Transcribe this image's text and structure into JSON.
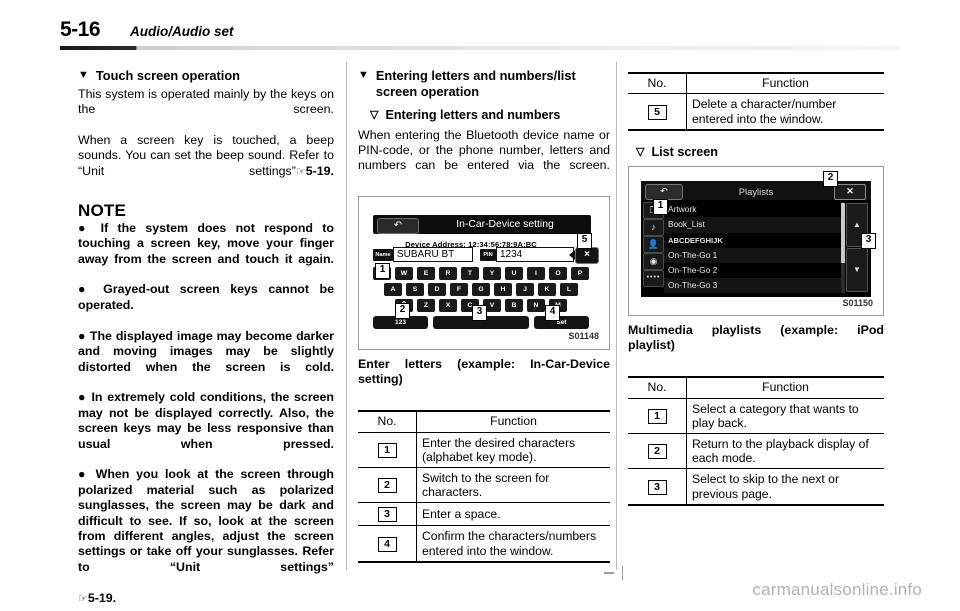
{
  "header": {
    "page_number": "5-16",
    "section_title": "Audio/Audio set"
  },
  "column1": {
    "heading": "Touch screen operation",
    "para1": "This system is operated mainly by the keys on the screen.",
    "para2": "When a screen key is touched, a beep sounds. You can set the beep sound. Refer to “Unit settings”",
    "para2_ref": "5-19.",
    "note_title": "NOTE",
    "bullets": [
      "If the system does not respond to touching a screen key, move your finger away from the screen and touch it again.",
      "Grayed-out screen keys cannot be operated.",
      "The displayed image may become darker and moving images may be slightly distorted when the screen is cold.",
      "In extremely cold conditions, the screen may not be displayed correctly. Also, the screen keys may be less responsive than usual when pressed.",
      "When you look at the screen through polarized material such as polarized sunglasses, the screen may be dark and difficult to see. If so, look at the screen from different angles, adjust the screen settings or take off your sunglasses. Refer to “Unit settings”"
    ],
    "last_ref": "5-19."
  },
  "column2": {
    "heading": "Entering letters and numbers/list screen operation",
    "subheading": "Entering letters and numbers",
    "para": "When entering the Bluetooth device name or PIN-code, or the phone number, letters and numbers can be entered via the screen.",
    "figure": {
      "id": "S01148",
      "back_icon": "back-arrow-icon",
      "title": "In-Car-Device setting",
      "device_address": "Device Address: 12:34:56:78:9A:BC",
      "name_label": "Name",
      "name_value": "SUBARU BT",
      "pin_label": "PIN",
      "pin_value": "1234",
      "delete_label": "×",
      "keyrow1": [
        "Q",
        "W",
        "E",
        "R",
        "T",
        "Y",
        "U",
        "I",
        "O",
        "P"
      ],
      "keyrow2": [
        "A",
        "S",
        "D",
        "F",
        "G",
        "H",
        "J",
        "K",
        "L"
      ],
      "keyrow3": [
        "⇧",
        "Z",
        "X",
        "C",
        "V",
        "B",
        "N",
        "M"
      ],
      "num_key": "123",
      "space_key": "",
      "set_key": "Set",
      "callouts": [
        "1",
        "2",
        "3",
        "4",
        "5"
      ]
    },
    "caption": "Enter letters (example: In-Car-Device setting)",
    "table": {
      "col_no": "No.",
      "col_function": "Function",
      "rows": [
        {
          "no": "1",
          "function": "Enter the desired characters (alphabet key mode)."
        },
        {
          "no": "2",
          "function": "Switch to the screen for characters."
        },
        {
          "no": "3",
          "function": "Enter a space."
        },
        {
          "no": "4",
          "function": "Confirm the characters/numbers entered into the window."
        }
      ]
    }
  },
  "column3": {
    "table_top": {
      "col_no": "No.",
      "col_function": "Function",
      "rows": [
        {
          "no": "5",
          "function": "Delete a character/number entered into the window."
        }
      ]
    },
    "subheading": "List screen",
    "figure": {
      "id": "S01150",
      "back_icon": "back-arrow-icon",
      "title": "Playlists",
      "close_label": "✕",
      "categories": [
        "playlist-stack-icon",
        "music-note-icon",
        "artist-icon",
        "album-disc-icon",
        "more-icon"
      ],
      "list_items": [
        "Artwork",
        "Book_List",
        "ABCDEFGHIJK",
        "On-The-Go 1",
        "On-The-Go 2",
        "On-The-Go 3"
      ],
      "page_up": "▲",
      "page_down": "▼",
      "callouts": [
        "1",
        "2",
        "3"
      ]
    },
    "caption": "Multimedia playlists (example: iPod playlist)",
    "table_bottom": {
      "col_no": "No.",
      "col_function": "Function",
      "rows": [
        {
          "no": "1",
          "function": "Select a category that wants to play back."
        },
        {
          "no": "2",
          "function": "Return to the playback display of each mode."
        },
        {
          "no": "3",
          "function": "Select to skip to the next or previous page."
        }
      ]
    }
  },
  "footer": {
    "watermark": "carmanualsonline.info"
  }
}
